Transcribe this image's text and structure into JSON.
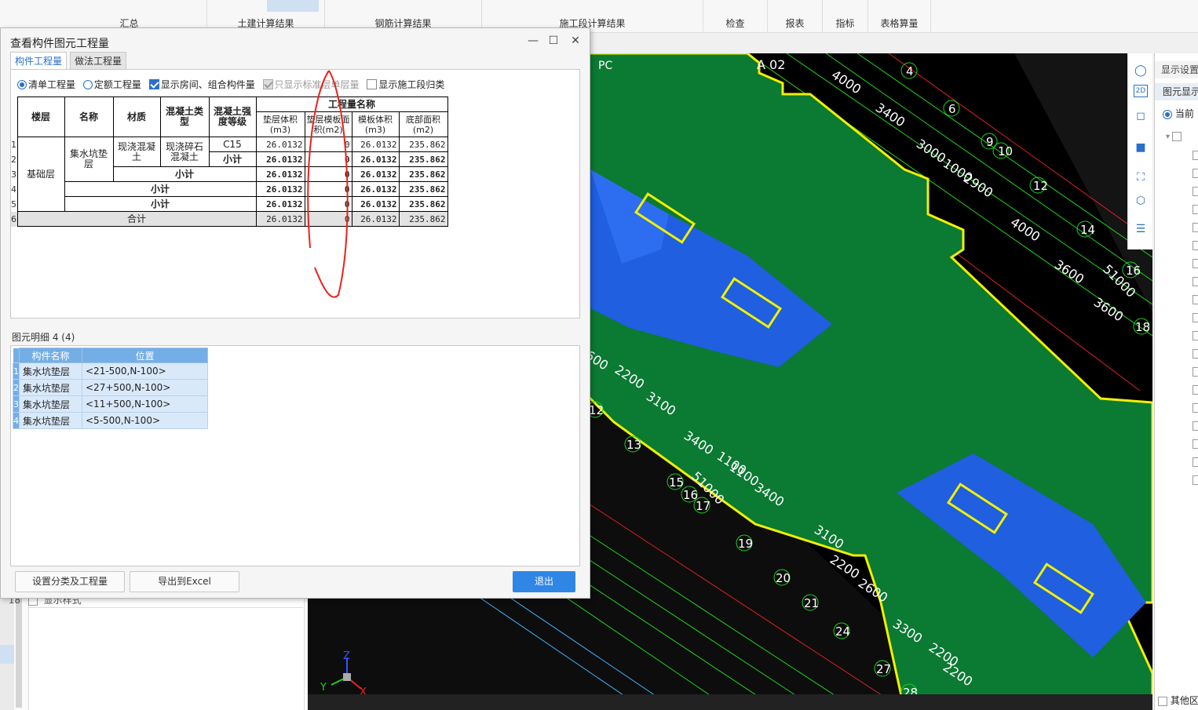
{
  "ribbon": {
    "groups": [
      "汇总",
      "土建计算结果",
      "钢筋计算结果",
      "施工段计算结果",
      "检查",
      "报表",
      "指标",
      "表格算量"
    ]
  },
  "background_left": {
    "row_num": "18",
    "row_label": "显示样式"
  },
  "dialog": {
    "title": "查看构件图元工程量",
    "tabs": [
      "构件工程量",
      "做法工程量"
    ],
    "options": {
      "list_qty": "清单工程量",
      "quota_qty": "定额工程量",
      "show_rooms": "显示房间、组合构件量",
      "std_floor_only": "只显示标准层单层量",
      "show_stage": "显示施工段归类"
    },
    "table": {
      "headers": {
        "floor": "楼层",
        "name": "名称",
        "material": "材质",
        "concrete_type": "混凝土类型",
        "strength": "混凝土强度等级",
        "qty_group": "工程量名称",
        "cushion_vol": "垫层体积(m3)",
        "cushion_form": "垫层模板面积(m2)",
        "form_vol": "模板体积(m3)",
        "bottom_area": "底部面积(m2)"
      },
      "row_numbers": [
        "1",
        "2",
        "3",
        "4",
        "5",
        "6"
      ],
      "floor": "基础层",
      "name": "集水坑垫层",
      "material": "现浇混凝土",
      "concrete_type": "现浇碎石混凝土",
      "strength": "C15",
      "subtotal": "小计",
      "total": "合计",
      "cushion_vol": "26.0132",
      "cushion_form": "0",
      "form_vol": "26.0132",
      "bottom_area": "235.862"
    },
    "detail": {
      "title": "图元明细  4 (4)",
      "headers": [
        "构件名称",
        "位置"
      ],
      "rows": [
        {
          "num": "1",
          "name": "集水坑垫层",
          "pos": "<21-500,N-100>"
        },
        {
          "num": "2",
          "name": "集水坑垫层",
          "pos": "<27+500,N-100>"
        },
        {
          "num": "3",
          "name": "集水坑垫层",
          "pos": "<11+500,N-100>"
        },
        {
          "num": "4",
          "name": "集水坑垫层",
          "pos": "<5-500,N-100>"
        }
      ]
    },
    "buttons": {
      "settings": "设置分类及工程量",
      "export": "导出到Excel",
      "exit": "退出"
    },
    "window_buttons": {
      "min": "—",
      "max": "☐",
      "close": "✕"
    }
  },
  "viewport": {
    "labels": [
      "A 02",
      "PC",
      "4",
      "6",
      "9",
      "10",
      "12",
      "14",
      "16",
      "18",
      "13",
      "15",
      "16",
      "17",
      "19",
      "20",
      "21",
      "24",
      "27",
      "28",
      "12"
    ],
    "dims": [
      "4000",
      "3400",
      "3000",
      "1000",
      "2900",
      "4000",
      "3600",
      "51000",
      "3600",
      "2600",
      "2200",
      "3100",
      "3400",
      "1100",
      "1100",
      "3400",
      "51000",
      "3100",
      "2200",
      "2600",
      "3300",
      "2200",
      "2200"
    ],
    "axis": {
      "z": "Z",
      "y": "Y",
      "x": "X"
    }
  },
  "right_panel": {
    "header": "显示设置",
    "subheader": "图元显示",
    "radio_label": "当前",
    "bottom_label": "其他区"
  },
  "colors": {
    "slab_green": "#0b7a33",
    "pit_blue": "#1f5fe0",
    "outline_yellow": "#f0f000",
    "accent_blue": "#2f86e5",
    "annot_red": "#e8231b"
  }
}
